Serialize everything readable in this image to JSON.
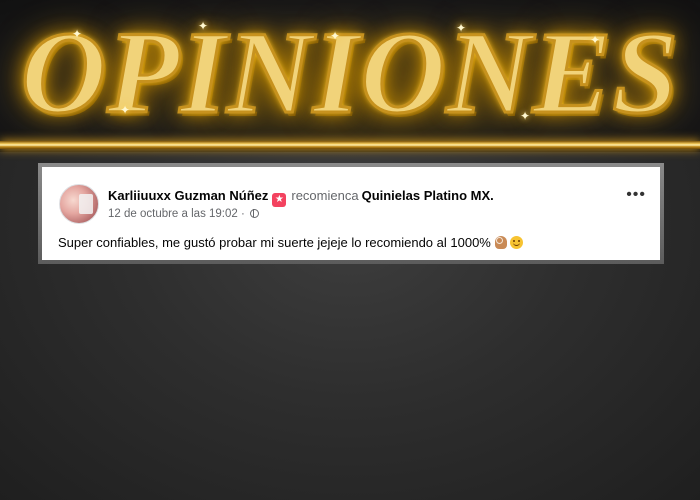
{
  "banner": {
    "title": "OPINIONES"
  },
  "post": {
    "author": "Karliiuuxx Guzman Núñez",
    "verb": "recomienca",
    "page": "Quinielas Platino MX.",
    "timestamp": "12 de octubre a las 19:02 ·",
    "text": "Super confiables,  me gustó probar mi suerte jejeje lo recomiendo al 1000%",
    "icons": {
      "badge": "star-badge-icon",
      "privacy": "globe-icon",
      "more": "more-options-icon",
      "emoji_1": "ok-hand-icon",
      "emoji_2": "smiling-face-icon"
    }
  },
  "colors": {
    "gold": "#f1d37a",
    "badge": "#f3425f",
    "secondary_text": "#65676b",
    "card": "#ffffff"
  }
}
